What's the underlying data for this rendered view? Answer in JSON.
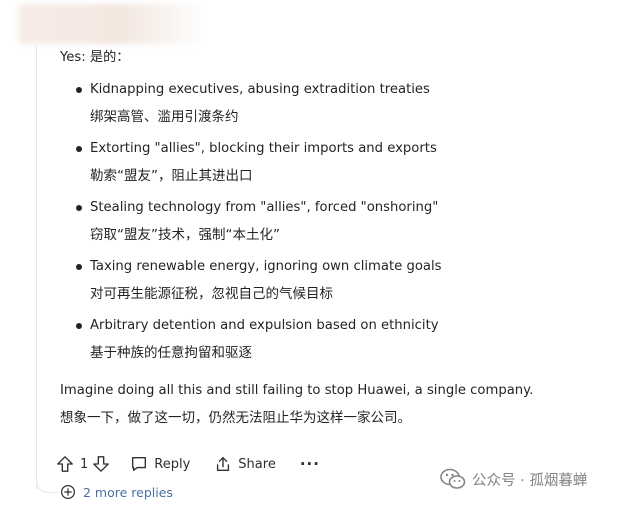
{
  "comment": {
    "intro": "Yes: 是的：",
    "points": [
      {
        "en": "Kidnapping executives, abusing extradition treaties",
        "zh": "绑架高管、滥用引渡条约"
      },
      {
        "en": "Extorting \"allies\", blocking their imports and exports",
        "zh": "勒索“盟友”，阻止其进出口"
      },
      {
        "en": "Stealing technology from \"allies\", forced \"onshoring\"",
        "zh": "窃取“盟友”技术，强制“本土化”"
      },
      {
        "en": "Taxing renewable energy, ignoring own climate goals",
        "zh": "对可再生能源征税，忽视自己的气候目标"
      },
      {
        "en": "Arbitrary detention and expulsion based on ethnicity",
        "zh": "基于种族的任意拘留和驱逐"
      }
    ],
    "outro_en": "Imagine doing all this and still failing to stop Huawei, a single company.",
    "outro_zh": "想象一下，做了这一切，仍然无法阻止华为这样一家公司。"
  },
  "actions": {
    "vote_count": "1",
    "reply_label": "Reply",
    "share_label": "Share",
    "more_label": "···"
  },
  "more_replies_label": "2 more replies",
  "watermark": {
    "text": "公众号 · 孤烟暮蝉",
    "icon": "wechat-icon"
  },
  "colors": {
    "link": "#4a6fa5",
    "text": "#1f2326",
    "thread_line": "#e6e8ea"
  }
}
